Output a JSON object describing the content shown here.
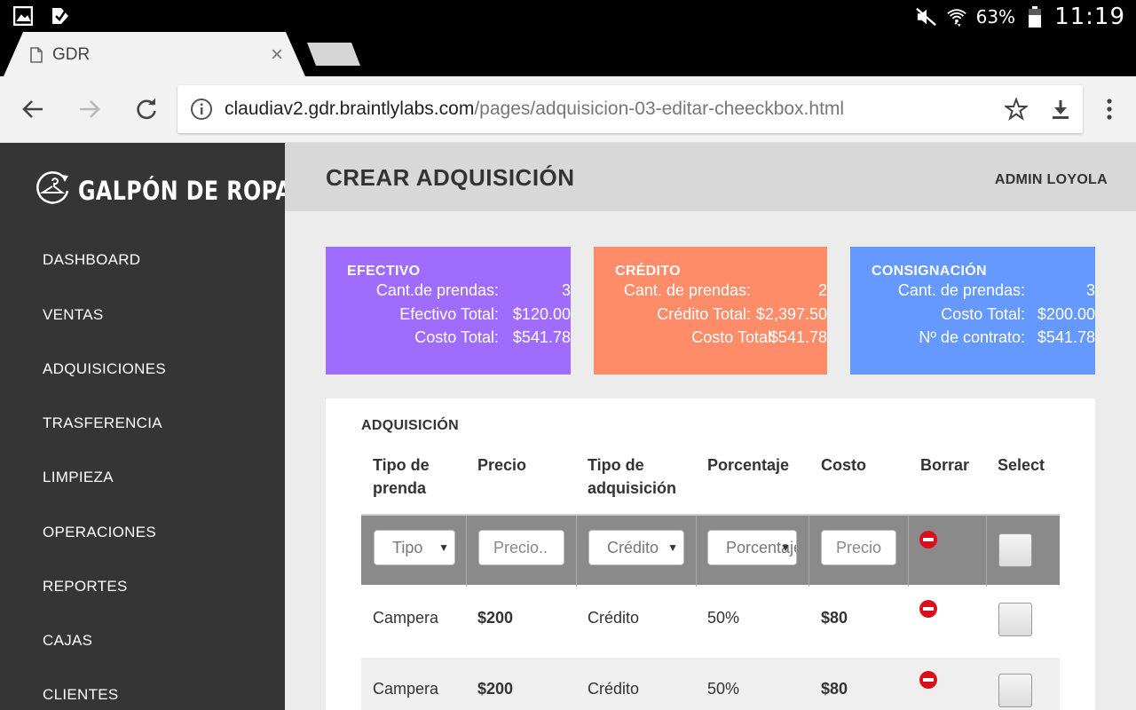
{
  "status_bar": {
    "battery": "63%",
    "time": "11:19",
    "icons": [
      "gallery-icon",
      "check-icon",
      "mute-icon",
      "wifi-icon",
      "battery-icon"
    ]
  },
  "browser": {
    "tab_title": "GDR",
    "url_host": "claudiav2.gdr.braintlylabs.com",
    "url_path": "/pages/adquisicion-03-editar-cheeckbox.html"
  },
  "sidebar": {
    "logo": "GALPÓN DE ROPA",
    "items": [
      {
        "label": "DASHBOARD"
      },
      {
        "label": "VENTAS"
      },
      {
        "label": "ADQUISICIONES"
      },
      {
        "label": "TRASFERENCIA"
      },
      {
        "label": "LIMPIEZA"
      },
      {
        "label": "OPERACIONES"
      },
      {
        "label": "REPORTES"
      },
      {
        "label": "CAJAS"
      },
      {
        "label": "CLIENTES"
      }
    ]
  },
  "header": {
    "title": "CREAR ADQUISICIÓN",
    "user": "ADMIN LOYOLA"
  },
  "cards": [
    {
      "title": "EFECTIVO",
      "color": "#a06cfd",
      "rows": [
        {
          "label": "Cant.de prendas:",
          "value": "3"
        },
        {
          "label": "Efectivo Total:",
          "value": "$120.00"
        },
        {
          "label": "Costo Total:",
          "value": "$541.78"
        }
      ]
    },
    {
      "title": "CRÉDITO",
      "color": "#ff8c69",
      "rows": [
        {
          "label": "Cant. de prendas:",
          "value": "2"
        },
        {
          "label": "Crédito Total:",
          "value": "$2,397.50"
        },
        {
          "label": "Costo Total:",
          "value": "$541.78"
        }
      ]
    },
    {
      "title": "CONSIGNACIÓN",
      "color": "#6699ff",
      "rows": [
        {
          "label": "Cant. de prendas:",
          "value": "3"
        },
        {
          "label": "Costo Total:",
          "value": "$200.00"
        },
        {
          "label": "Nº de contrato:",
          "value": "$541.78"
        }
      ]
    }
  ],
  "table": {
    "title": "ADQUISICIÓN",
    "headers": [
      {
        "line1": "Tipo de",
        "line2": "prenda"
      },
      {
        "line1": "Precio",
        "line2": ""
      },
      {
        "line1": "Tipo de",
        "line2": "adquisición"
      },
      {
        "line1": "Porcentaje",
        "line2": ""
      },
      {
        "line1": "Costo",
        "line2": ""
      },
      {
        "line1": "Borrar",
        "line2": ""
      },
      {
        "line1": "Select",
        "line2": ""
      }
    ],
    "input_row": {
      "tipo": "Tipo",
      "precio_placeholder": "Precio..",
      "adquisicion": "Crédito",
      "porcentaje": "Porcentaje",
      "costo_placeholder": "Precio"
    },
    "rows": [
      {
        "prenda": "Campera",
        "precio": "$200",
        "tipo": "Crédito",
        "porcentaje": "50%",
        "costo": "$80"
      },
      {
        "prenda": "Campera",
        "precio": "$200",
        "tipo": "Crédito",
        "porcentaje": "50%",
        "costo": "$80"
      }
    ]
  }
}
